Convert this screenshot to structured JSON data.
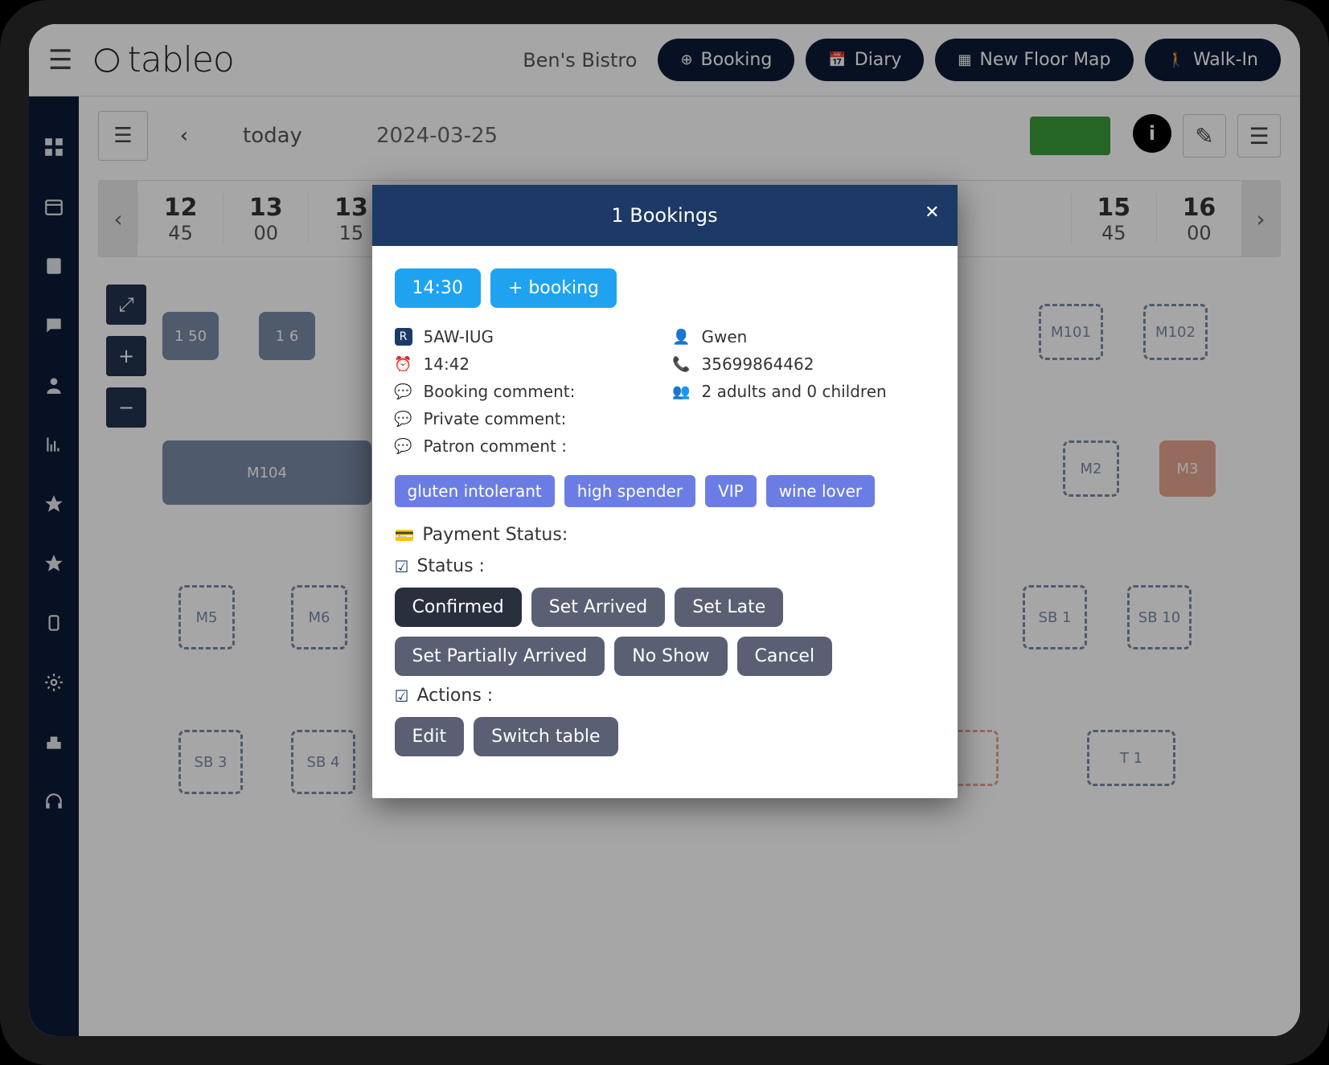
{
  "header": {
    "logo_text": "tableo",
    "venue": "Ben's Bistro",
    "actions": {
      "booking": "Booking",
      "diary": "Diary",
      "new_floor_map": "New Floor Map",
      "walk_in": "Walk-In"
    }
  },
  "toolbar": {
    "today": "today",
    "date": "2024-03-25"
  },
  "time_slots": [
    {
      "h": "12",
      "m": "45"
    },
    {
      "h": "13",
      "m": "00"
    },
    {
      "h": "13",
      "m": "15"
    },
    {
      "h": "15",
      "m": "45"
    },
    {
      "h": "16",
      "m": "00"
    }
  ],
  "floor_tables": {
    "t150": "1 50",
    "t16": "1 6",
    "m101": "M101",
    "m102": "M102",
    "m104": "M104",
    "m2": "M2",
    "m3": "M3",
    "m5": "M5",
    "m6": "M6",
    "sb1": "SB 1",
    "sb10": "SB 10",
    "sb3": "SB 3",
    "sb4": "SB 4",
    "t1": "T 1"
  },
  "modal": {
    "title": "1 Bookings",
    "time_chip": "14:30",
    "add_booking": "+ booking",
    "booking_ref": "5AW-IUG",
    "clock": "14:42",
    "booking_comment_label": "Booking comment:",
    "private_comment_label": "Private comment:",
    "patron_comment_label": "Patron comment :",
    "guest_name": "Gwen",
    "phone": "35699864462",
    "party": "2 adults and 0 children",
    "tags": [
      "gluten intolerant",
      "high spender",
      "VIP",
      "wine lover"
    ],
    "payment_label": "Payment Status:",
    "status_label": "Status :",
    "status_buttons": [
      "Confirmed",
      "Set Arrived",
      "Set Late",
      "Set Partially Arrived",
      "No Show",
      "Cancel"
    ],
    "actions_label": "Actions :",
    "action_buttons": [
      "Edit",
      "Switch table"
    ]
  }
}
